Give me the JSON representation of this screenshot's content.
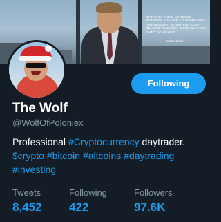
{
  "banner": {
    "quote": "The only thing standing between you and your dream is the bullshit story you keep telling yourself as to why you can't achieve it",
    "quote_author": "Jordan Belfort"
  },
  "follow_button": {
    "label": "Following"
  },
  "profile": {
    "name": "The Wolf",
    "handle": "@WolfOfPoloniex"
  },
  "bio": {
    "text_1": "Professional ",
    "tag_1": "#Cryptocurrency",
    "text_2": " daytrader.",
    "tags": [
      "$crypto",
      "#bitcoin",
      "#altcoins",
      "#daytrading",
      "#investing"
    ]
  },
  "stats": {
    "tweets": {
      "label": "Tweets",
      "value": "8,452"
    },
    "following": {
      "label": "Following",
      "value": "422"
    },
    "followers": {
      "label": "Followers",
      "value": "97.6K"
    }
  },
  "colors": {
    "background": "#141d26",
    "accent": "#1d9bf0",
    "muted": "#8899a6"
  }
}
